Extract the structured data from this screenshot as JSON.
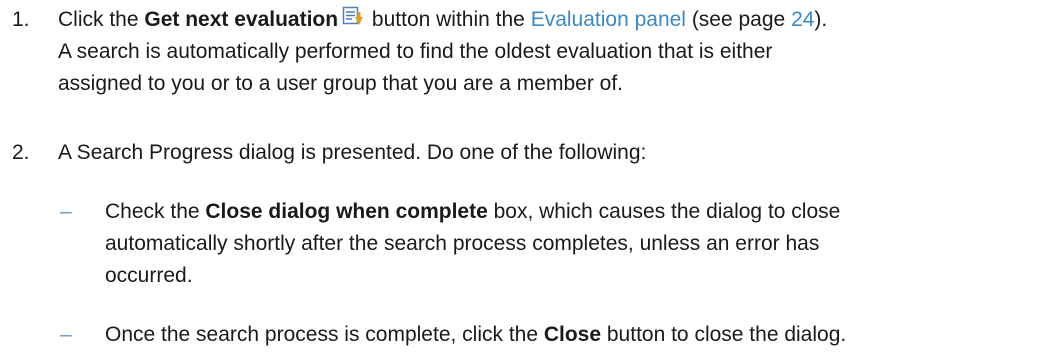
{
  "step1": {
    "number": "1.",
    "pre": "Click the ",
    "button_name": "Get next evaluation",
    "mid": " button within the ",
    "link_panel": "Evaluation panel",
    "see_pre": " (see page ",
    "page_link": "24",
    "see_post": ").",
    "line2": "A search is automatically performed to find the oldest evaluation that is either",
    "line3": "assigned to you or to a user group that you are a member of.",
    "icon": "get-next-evaluation-icon"
  },
  "step2": {
    "number": "2.",
    "text": "A Search Progress dialog is presented. Do one of the following:",
    "bullets": [
      {
        "dash": "–",
        "pre": "Check the ",
        "bold": "Close dialog when complete",
        "post": " box, which causes the dialog to close",
        "line2": "automatically shortly after the search process completes, unless an error has",
        "line3": "occurred."
      },
      {
        "dash": "–",
        "pre": "Once the search process is complete, click the ",
        "bold": "Close",
        "post": " button to close the dialog."
      }
    ]
  },
  "colors": {
    "text": "#1a1a1a",
    "link": "#3c88c6",
    "dash": "#6a9bc3",
    "icon_arrow": "#e0a020",
    "icon_doc": "#4a7fc0"
  }
}
